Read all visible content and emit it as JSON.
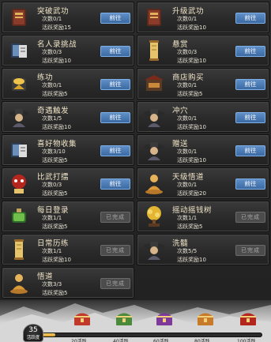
{
  "tasks": [
    {
      "title": "突破武功",
      "count": "次数0/1",
      "reward": "活跃奖励15",
      "action": "前往",
      "icon": "book-red-icon"
    },
    {
      "title": "升级武功",
      "count": "次数0/1",
      "reward": "活跃奖励10",
      "action": "前往",
      "icon": "book-red-icon"
    },
    {
      "title": "名人录挑战",
      "count": "次数0/3",
      "reward": "活跃奖励10",
      "action": "前往",
      "icon": "scroll-book-icon"
    },
    {
      "title": "悬赏",
      "count": "次数0/3",
      "reward": "活跃奖励10",
      "action": "前往",
      "icon": "paper-scroll-icon"
    },
    {
      "title": "练功",
      "count": "次数0/1",
      "reward": "活跃奖励5",
      "action": "前往",
      "icon": "gold-ingot-icon"
    },
    {
      "title": "商店购买",
      "count": "次数0/1",
      "reward": "活跃奖励5",
      "action": "前往",
      "icon": "shop-stall-icon"
    },
    {
      "title": "奇遇触发",
      "count": "次数1/5",
      "reward": "活跃奖励10",
      "action": "前往",
      "icon": "hat-figure-icon"
    },
    {
      "title": "冲穴",
      "count": "次数0/1",
      "reward": "活跃奖励10",
      "action": "前往",
      "icon": "hat-figure-icon"
    },
    {
      "title": "喜好物收集",
      "count": "次数3/10",
      "reward": "活跃奖励5",
      "action": "前往",
      "icon": "scroll-book-icon"
    },
    {
      "title": "赠送",
      "count": "次数0/1",
      "reward": "活跃奖励10",
      "action": "前往",
      "icon": "hat-figure-icon"
    },
    {
      "title": "比武打擂",
      "count": "次数0/3",
      "reward": "活跃奖励5",
      "action": "前往",
      "icon": "red-mask-icon"
    },
    {
      "title": "天级悟道",
      "count": "次数0/1",
      "reward": "活跃奖励20",
      "action": "前往",
      "icon": "buddha-icon"
    },
    {
      "title": "每日登录",
      "count": "次数1/1",
      "reward": "活跃奖励5",
      "action": "已完成",
      "icon": "green-stone-icon"
    },
    {
      "title": "摇动摇钱树",
      "count": "次数1/1",
      "reward": "活跃奖励5",
      "action": "已完成",
      "icon": "money-tree-icon"
    },
    {
      "title": "日常历练",
      "count": "次数1/1",
      "reward": "活跃奖励10",
      "action": "已完成",
      "icon": "paper-scroll-icon"
    },
    {
      "title": "洗髓",
      "count": "次数5/5",
      "reward": "活跃奖励10",
      "action": "已完成",
      "icon": "hat-figure-icon"
    },
    {
      "title": "悟道",
      "count": "次数3/3",
      "reward": "活跃奖励5",
      "action": "已完成",
      "icon": "buddha-icon"
    }
  ],
  "activity": {
    "value": "35",
    "label": "活跃度",
    "progress": 0.1
  },
  "milestones": [
    {
      "label": "20活跃",
      "icon": "chest-red-icon",
      "color": "#c0392b"
    },
    {
      "label": "40活跃",
      "icon": "chest-green-icon",
      "color": "#4b8a3a"
    },
    {
      "label": "60活跃",
      "icon": "chest-purple-icon",
      "color": "#7d3a9a"
    },
    {
      "label": "80活跃",
      "icon": "chest-orange-icon",
      "color": "#c77b2a"
    },
    {
      "label": "100活跃",
      "icon": "chest-red-gold-icon",
      "color": "#b3261e"
    }
  ]
}
